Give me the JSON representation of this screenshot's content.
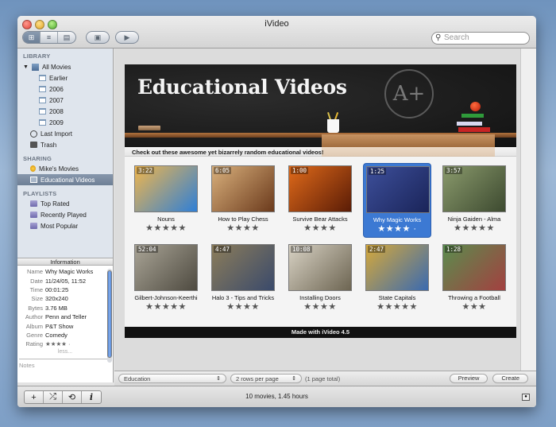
{
  "window": {
    "title": "iVideo"
  },
  "toolbar": {
    "view_buttons": [
      {
        "icon": "grid-view-icon",
        "glyph": "⊞",
        "active": true
      },
      {
        "icon": "list-view-icon",
        "glyph": "≡",
        "active": false
      },
      {
        "icon": "detail-view-icon",
        "glyph": "▤",
        "active": false
      }
    ],
    "present_glyph": "▣",
    "play_glyph": "▶",
    "search": {
      "placeholder": "Search",
      "icon": "search-icon",
      "glyph": "🔍"
    }
  },
  "sidebar": {
    "library_header": "LIBRARY",
    "library": [
      {
        "label": "All Movies",
        "icon": "movies-icon",
        "expanded": true
      },
      {
        "label": "Earlier",
        "icon": "calendar-icon"
      },
      {
        "label": "2006",
        "icon": "calendar-icon"
      },
      {
        "label": "2007",
        "icon": "calendar-icon"
      },
      {
        "label": "2008",
        "icon": "calendar-icon"
      },
      {
        "label": "2009",
        "icon": "calendar-icon"
      },
      {
        "label": "Last Import",
        "icon": "clock-icon"
      },
      {
        "label": "Trash",
        "icon": "trash-icon"
      }
    ],
    "sharing_header": "SHARING",
    "sharing": [
      {
        "label": "Mike's Movies",
        "icon": "shared-bulb-icon"
      },
      {
        "label": "Educational Videos",
        "icon": "web-page-icon",
        "selected": true
      }
    ],
    "playlists_header": "PLAYLISTS",
    "playlists": [
      {
        "label": "Top Rated",
        "icon": "playlist-icon"
      },
      {
        "label": "Recently Played",
        "icon": "playlist-icon"
      },
      {
        "label": "Most Popular",
        "icon": "playlist-icon"
      }
    ]
  },
  "info": {
    "header": "Information",
    "rows": [
      {
        "k": "Name",
        "v": "Why Magic Works"
      },
      {
        "k": "Date",
        "v": "11/24/05, 11:52"
      },
      {
        "k": "Time",
        "v": "00:01:25"
      },
      {
        "k": "Size",
        "v": "320x240"
      },
      {
        "k": "Bytes",
        "v": "3.76 MB"
      },
      {
        "k": "Author",
        "v": "Penn and Teller"
      },
      {
        "k": "Album",
        "v": "P&T Show"
      },
      {
        "k": "Genre",
        "v": "Comedy"
      },
      {
        "k": "Rating",
        "v": "★★★★ ·"
      }
    ],
    "less": "less...",
    "notes_label": "Notes"
  },
  "page": {
    "title": "Educational Videos",
    "tagline": "Check out these awesome yet bizarrely random educational videos!",
    "footer": "Made with iVideo 4.5",
    "videos": [
      {
        "title": "Nouns",
        "duration": "3:22",
        "rating": 5,
        "stars": "★★★★★",
        "colors": [
          "#f0b64c",
          "#2f7fd6"
        ]
      },
      {
        "title": "How to Play Chess",
        "duration": "6:05",
        "rating": 4,
        "stars": "★★★★",
        "colors": [
          "#d9b07c",
          "#6b3a1c"
        ]
      },
      {
        "title": "Survive Bear Attacks",
        "duration": "1:00",
        "rating": 4,
        "stars": "★★★★",
        "colors": [
          "#e06a1a",
          "#5a1c06"
        ]
      },
      {
        "title": "Why Magic Works",
        "duration": "1:25",
        "rating": 4,
        "stars": "★★★★ ·",
        "colors": [
          "#3d4f9a",
          "#1a2459"
        ],
        "selected": true
      },
      {
        "title": "Ninja Gaiden - Alma",
        "duration": "3:57",
        "rating": 5,
        "stars": "★★★★★",
        "colors": [
          "#8a9a6c",
          "#3d4a30"
        ]
      },
      {
        "title": "Gilbert-Johnson-Keerthi",
        "duration": "52:04",
        "rating": 5,
        "stars": "★★★★★",
        "colors": [
          "#a9a496",
          "#4e4a40"
        ]
      },
      {
        "title": "Halo 3 - Tips and Tricks",
        "duration": "4:47",
        "rating": 4,
        "stars": "★★★★",
        "colors": [
          "#8c7d5a",
          "#3a4a6b"
        ]
      },
      {
        "title": "Installing Doors",
        "duration": "10:08",
        "rating": 4,
        "stars": "★★★★",
        "colors": [
          "#d8d2c4",
          "#6d6552"
        ]
      },
      {
        "title": "State Capitals",
        "duration": "2:47",
        "rating": 5,
        "stars": "★★★★★",
        "colors": [
          "#d6a93a",
          "#3a6ab0"
        ]
      },
      {
        "title": "Throwing a Football",
        "duration": "1:28",
        "rating": 3,
        "stars": "★★★",
        "colors": [
          "#5a8d4e",
          "#a34040"
        ]
      }
    ]
  },
  "bottom": {
    "theme": "Education",
    "rows": "2 rows per page",
    "pages": "(1 page total)",
    "preview": "Preview",
    "create": "Create"
  },
  "status": {
    "text": "10 movies, 1.45 hours",
    "actions": [
      {
        "icon": "add-icon",
        "glyph": "+"
      },
      {
        "icon": "shuffle-icon",
        "glyph": "⤮"
      },
      {
        "icon": "repeat-icon",
        "glyph": "⟲"
      },
      {
        "icon": "info-icon",
        "glyph": "i"
      }
    ]
  }
}
